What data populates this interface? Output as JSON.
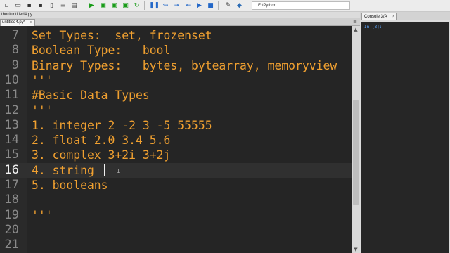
{
  "toolbar": {
    "path_value": "E:\\Python",
    "icons": [
      "new-file",
      "open",
      "save",
      "save-all",
      "tab",
      "browse",
      "print",
      "run",
      "run-file",
      "run-cell",
      "run-cell-advance",
      "rerun",
      "debug",
      "step",
      "step-into",
      "step-return",
      "continue",
      "stop",
      "settings",
      "python"
    ]
  },
  "editor": {
    "file_path": "thon\\untitled4.py",
    "tab_label": "untitled4.py*",
    "tab_close": "×",
    "tab_menu": "≡",
    "current_line": "16",
    "lines": [
      {
        "num": "7",
        "text": "Set Types:  set, frozenset"
      },
      {
        "num": "8",
        "text": "Boolean Type:   bool"
      },
      {
        "num": "9",
        "text": "Binary Types:   bytes, bytearray, memoryview"
      },
      {
        "num": "10",
        "text": "'''"
      },
      {
        "num": "11",
        "text": "#Basic Data Types"
      },
      {
        "num": "12",
        "text": "'''"
      },
      {
        "num": "13",
        "text": "1. integer 2 -2 3 -5 55555"
      },
      {
        "num": "14",
        "text": "2. float 2.0 3.4 5.6"
      },
      {
        "num": "15",
        "text": "3. complex 3+2i 3+2j"
      },
      {
        "num": "16",
        "text": "4. string "
      },
      {
        "num": "17",
        "text": "5. booleans"
      },
      {
        "num": "18",
        "text": ""
      },
      {
        "num": "19",
        "text": "'''"
      },
      {
        "num": "20",
        "text": ""
      },
      {
        "num": "21",
        "text": ""
      }
    ]
  },
  "console": {
    "tab_label": "Console 3/A",
    "tab_close": "×",
    "prompt": "In [8]:"
  },
  "colors": {
    "code_text": "#f0a030",
    "editor_bg": "#252525",
    "line_number": "#8a8a8a",
    "console_prompt": "#5fa8ff"
  }
}
